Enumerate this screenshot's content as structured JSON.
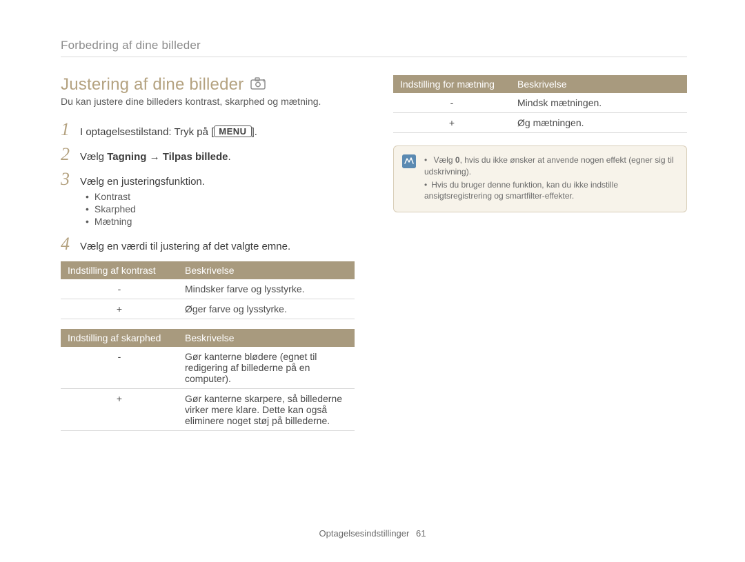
{
  "breadcrumb": "Forbedring af dine billeder",
  "heading": "Justering af dine billeder",
  "intro": "Du kan justere dine billeders kontrast, skarphed og mætning.",
  "steps": {
    "s1": {
      "num": "1",
      "pre": "I optagelsestilstand: Tryk på [",
      "menu": "MENU",
      "post": "]."
    },
    "s2": {
      "num": "2",
      "pre": "Vælg ",
      "bold": "Tagning → Tilpas billede",
      "post": "."
    },
    "s3": {
      "num": "3",
      "text": "Vælg en justeringsfunktion."
    },
    "s3_items": [
      "Kontrast",
      "Skarphed",
      "Mætning"
    ],
    "s4": {
      "num": "4",
      "text": "Vælg en værdi til justering af det valgte emne."
    }
  },
  "table_contrast": {
    "h1": "Indstilling af kontrast",
    "h2": "Beskrivelse",
    "rows": [
      {
        "sym": "-",
        "desc": "Mindsker farve og lysstyrke."
      },
      {
        "sym": "+",
        "desc": "Øger farve og lysstyrke."
      }
    ]
  },
  "table_sharp": {
    "h1": "Indstilling af skarphed",
    "h2": "Beskrivelse",
    "rows": [
      {
        "sym": "-",
        "desc": "Gør kanterne blødere (egnet til redigering af billederne på en computer)."
      },
      {
        "sym": "+",
        "desc": "Gør kanterne skarpere, så billederne virker mere klare. Dette kan også eliminere noget støj på billederne."
      }
    ]
  },
  "table_sat": {
    "h1": "Indstilling for mætning",
    "h2": "Beskrivelse",
    "rows": [
      {
        "sym": "-",
        "desc": "Mindsk mætningen."
      },
      {
        "sym": "+",
        "desc": "Øg mætningen."
      }
    ]
  },
  "note": {
    "items": [
      {
        "pre": "Vælg ",
        "bold": "0",
        "post": ", hvis du ikke ønsker at anvende nogen effekt (egner sig til udskrivning)."
      },
      {
        "text": "Hvis du bruger denne funktion, kan du ikke indstille ansigtsregistrering og smartfilter-effekter."
      }
    ]
  },
  "footer": {
    "section": "Optagelsesindstillinger",
    "page": "61"
  }
}
